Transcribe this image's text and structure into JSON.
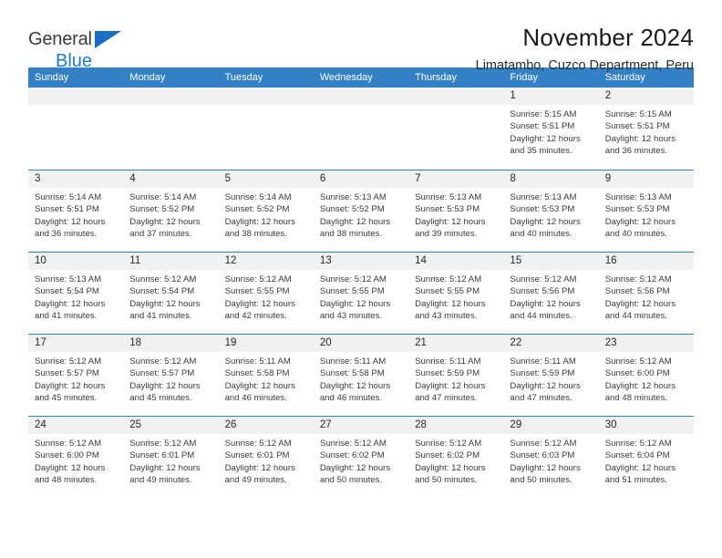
{
  "brand": {
    "name_top": "General",
    "name_bottom": "Blue",
    "triangle_color": "#1b6fc1",
    "text_color": "#3a3a3a",
    "blue_color": "#1b7bd0"
  },
  "header": {
    "title": "November 2024",
    "subtitle": "Limatambo, Cuzco Department, Peru"
  },
  "theme": {
    "header_bg": "#3480c4",
    "header_text": "#ffffff",
    "date_band_bg": "#f1f1f1",
    "row_divider": "#3480c4",
    "body_text": "#3a3a3a"
  },
  "weekdays": [
    "Sunday",
    "Monday",
    "Tuesday",
    "Wednesday",
    "Thursday",
    "Friday",
    "Saturday"
  ],
  "weeks": [
    [
      {
        "date": "",
        "lines": []
      },
      {
        "date": "",
        "lines": []
      },
      {
        "date": "",
        "lines": []
      },
      {
        "date": "",
        "lines": []
      },
      {
        "date": "",
        "lines": []
      },
      {
        "date": "1",
        "lines": [
          "Sunrise: 5:15 AM",
          "Sunset: 5:51 PM",
          "Daylight: 12 hours",
          "and 35 minutes."
        ]
      },
      {
        "date": "2",
        "lines": [
          "Sunrise: 5:15 AM",
          "Sunset: 5:51 PM",
          "Daylight: 12 hours",
          "and 36 minutes."
        ]
      }
    ],
    [
      {
        "date": "3",
        "lines": [
          "Sunrise: 5:14 AM",
          "Sunset: 5:51 PM",
          "Daylight: 12 hours",
          "and 36 minutes."
        ]
      },
      {
        "date": "4",
        "lines": [
          "Sunrise: 5:14 AM",
          "Sunset: 5:52 PM",
          "Daylight: 12 hours",
          "and 37 minutes."
        ]
      },
      {
        "date": "5",
        "lines": [
          "Sunrise: 5:14 AM",
          "Sunset: 5:52 PM",
          "Daylight: 12 hours",
          "and 38 minutes."
        ]
      },
      {
        "date": "6",
        "lines": [
          "Sunrise: 5:13 AM",
          "Sunset: 5:52 PM",
          "Daylight: 12 hours",
          "and 38 minutes."
        ]
      },
      {
        "date": "7",
        "lines": [
          "Sunrise: 5:13 AM",
          "Sunset: 5:53 PM",
          "Daylight: 12 hours",
          "and 39 minutes."
        ]
      },
      {
        "date": "8",
        "lines": [
          "Sunrise: 5:13 AM",
          "Sunset: 5:53 PM",
          "Daylight: 12 hours",
          "and 40 minutes."
        ]
      },
      {
        "date": "9",
        "lines": [
          "Sunrise: 5:13 AM",
          "Sunset: 5:53 PM",
          "Daylight: 12 hours",
          "and 40 minutes."
        ]
      }
    ],
    [
      {
        "date": "10",
        "lines": [
          "Sunrise: 5:13 AM",
          "Sunset: 5:54 PM",
          "Daylight: 12 hours",
          "and 41 minutes."
        ]
      },
      {
        "date": "11",
        "lines": [
          "Sunrise: 5:12 AM",
          "Sunset: 5:54 PM",
          "Daylight: 12 hours",
          "and 41 minutes."
        ]
      },
      {
        "date": "12",
        "lines": [
          "Sunrise: 5:12 AM",
          "Sunset: 5:55 PM",
          "Daylight: 12 hours",
          "and 42 minutes."
        ]
      },
      {
        "date": "13",
        "lines": [
          "Sunrise: 5:12 AM",
          "Sunset: 5:55 PM",
          "Daylight: 12 hours",
          "and 43 minutes."
        ]
      },
      {
        "date": "14",
        "lines": [
          "Sunrise: 5:12 AM",
          "Sunset: 5:55 PM",
          "Daylight: 12 hours",
          "and 43 minutes."
        ]
      },
      {
        "date": "15",
        "lines": [
          "Sunrise: 5:12 AM",
          "Sunset: 5:56 PM",
          "Daylight: 12 hours",
          "and 44 minutes."
        ]
      },
      {
        "date": "16",
        "lines": [
          "Sunrise: 5:12 AM",
          "Sunset: 5:56 PM",
          "Daylight: 12 hours",
          "and 44 minutes."
        ]
      }
    ],
    [
      {
        "date": "17",
        "lines": [
          "Sunrise: 5:12 AM",
          "Sunset: 5:57 PM",
          "Daylight: 12 hours",
          "and 45 minutes."
        ]
      },
      {
        "date": "18",
        "lines": [
          "Sunrise: 5:12 AM",
          "Sunset: 5:57 PM",
          "Daylight: 12 hours",
          "and 45 minutes."
        ]
      },
      {
        "date": "19",
        "lines": [
          "Sunrise: 5:11 AM",
          "Sunset: 5:58 PM",
          "Daylight: 12 hours",
          "and 46 minutes."
        ]
      },
      {
        "date": "20",
        "lines": [
          "Sunrise: 5:11 AM",
          "Sunset: 5:58 PM",
          "Daylight: 12 hours",
          "and 46 minutes."
        ]
      },
      {
        "date": "21",
        "lines": [
          "Sunrise: 5:11 AM",
          "Sunset: 5:59 PM",
          "Daylight: 12 hours",
          "and 47 minutes."
        ]
      },
      {
        "date": "22",
        "lines": [
          "Sunrise: 5:11 AM",
          "Sunset: 5:59 PM",
          "Daylight: 12 hours",
          "and 47 minutes."
        ]
      },
      {
        "date": "23",
        "lines": [
          "Sunrise: 5:12 AM",
          "Sunset: 6:00 PM",
          "Daylight: 12 hours",
          "and 48 minutes."
        ]
      }
    ],
    [
      {
        "date": "24",
        "lines": [
          "Sunrise: 5:12 AM",
          "Sunset: 6:00 PM",
          "Daylight: 12 hours",
          "and 48 minutes."
        ]
      },
      {
        "date": "25",
        "lines": [
          "Sunrise: 5:12 AM",
          "Sunset: 6:01 PM",
          "Daylight: 12 hours",
          "and 49 minutes."
        ]
      },
      {
        "date": "26",
        "lines": [
          "Sunrise: 5:12 AM",
          "Sunset: 6:01 PM",
          "Daylight: 12 hours",
          "and 49 minutes."
        ]
      },
      {
        "date": "27",
        "lines": [
          "Sunrise: 5:12 AM",
          "Sunset: 6:02 PM",
          "Daylight: 12 hours",
          "and 50 minutes."
        ]
      },
      {
        "date": "28",
        "lines": [
          "Sunrise: 5:12 AM",
          "Sunset: 6:02 PM",
          "Daylight: 12 hours",
          "and 50 minutes."
        ]
      },
      {
        "date": "29",
        "lines": [
          "Sunrise: 5:12 AM",
          "Sunset: 6:03 PM",
          "Daylight: 12 hours",
          "and 50 minutes."
        ]
      },
      {
        "date": "30",
        "lines": [
          "Sunrise: 5:12 AM",
          "Sunset: 6:04 PM",
          "Daylight: 12 hours",
          "and 51 minutes."
        ]
      }
    ]
  ]
}
